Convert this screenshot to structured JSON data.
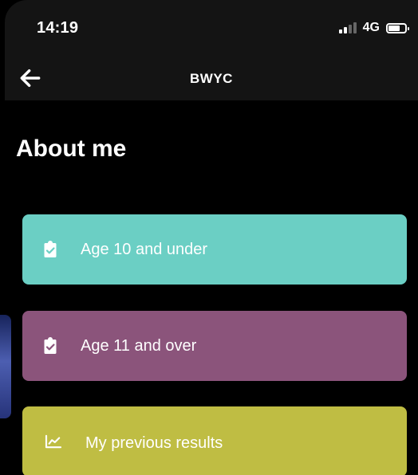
{
  "status_bar": {
    "time": "14:19",
    "network": "4G",
    "icons": [
      "signal-icon",
      "battery-icon"
    ]
  },
  "app_bar": {
    "title": "BWYC",
    "back_icon": "arrow-left-icon"
  },
  "page": {
    "title": "About me"
  },
  "menu": [
    {
      "label": "Age 10 and under",
      "icon": "clipboard-check-icon",
      "color": "#6BCFC4"
    },
    {
      "label": "Age 11 and over",
      "icon": "clipboard-check-icon",
      "color": "#8B547B"
    },
    {
      "label": "My previous results",
      "icon": "line-chart-icon",
      "color": "#BFBD43"
    }
  ]
}
